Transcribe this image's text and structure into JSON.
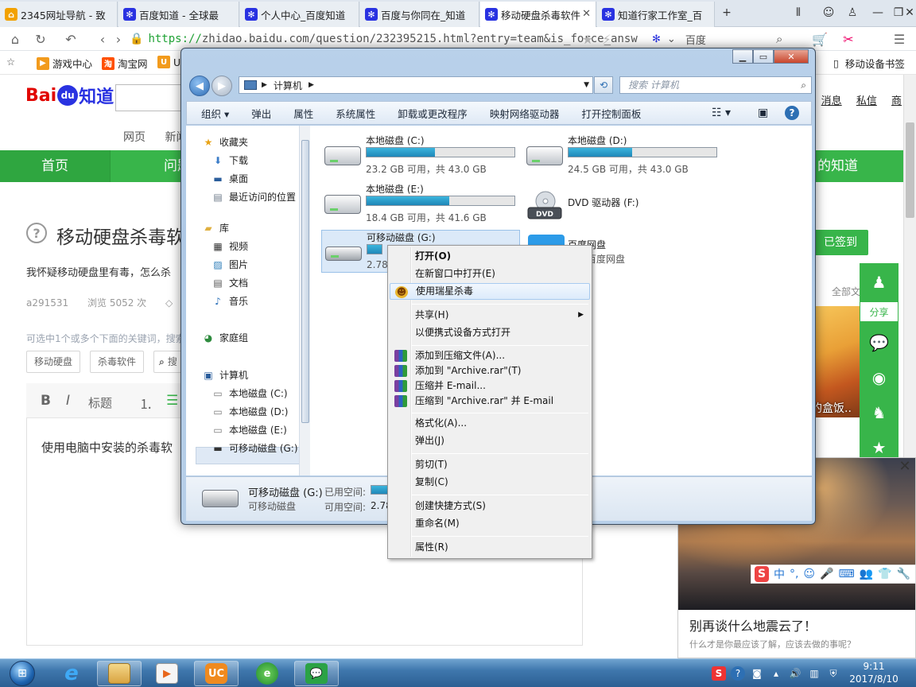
{
  "browser": {
    "tabs": [
      {
        "label": "2345网址导航 - 致",
        "icon": "2345-icon"
      },
      {
        "label": "百度知道 - 全球最",
        "icon": "baidu-paw-icon"
      },
      {
        "label": "个人中心_百度知道",
        "icon": "baidu-paw-icon"
      },
      {
        "label": "百度与你同在_知道",
        "icon": "baidu-paw-icon"
      },
      {
        "label": "移动硬盘杀毒软件",
        "icon": "baidu-paw-icon"
      },
      {
        "label": "知道行家工作室_百",
        "icon": "baidu-paw-icon"
      }
    ],
    "new_tab": "+",
    "url_https": "https://",
    "url_rest": "zhidao.baidu.com/question/232395215.html?entry=team&is_force_answ",
    "search_engine": "百度",
    "bookmarks": [
      "游戏中心",
      "淘宝网",
      "U"
    ],
    "mobile_bookmarks": "移动设备书签"
  },
  "page": {
    "logo_bai": "Bai",
    "logo_du": "du",
    "logo_zhidao": "知道",
    "subnav": [
      "网页",
      "新闻"
    ],
    "green_nav": {
      "home": "首页",
      "ask": "问题",
      "mine": "的知道"
    },
    "top_links": [
      "消息",
      "私信",
      "商"
    ],
    "question_title": "移动硬盘杀毒软",
    "question_desc": "我怀疑移动硬盘里有毒，怎么杀",
    "meta": {
      "user": "a291531",
      "views": "浏览 5052 次"
    },
    "hint": "可选中1个或多个下面的关键词，搜索",
    "tags": [
      "移动硬盘",
      "杀毒软件",
      "搜"
    ],
    "editor": {
      "bold": "B",
      "italic": "I",
      "heading": "标题"
    },
    "answer_text": "使用电脑中安装的杀毒软",
    "signed": "已签到",
    "all_questions": "全部文",
    "share_label": "分享",
    "food_caption": "的盒饭..",
    "news_title": "别再谈什么地震云了！",
    "news_sub": "什么才是你最应该了解，应该去做的事呢？"
  },
  "ime": {
    "mode": "中",
    "punct": "°,"
  },
  "explorer": {
    "breadcrumb": "计算机",
    "search_placeholder": "搜索 计算机",
    "commands": [
      "组织 ▾",
      "弹出",
      "属性",
      "系统属性",
      "卸载或更改程序",
      "映射网络驱动器",
      "打开控制面板"
    ],
    "nav": {
      "favorites": "收藏夹",
      "downloads": "下载",
      "desktop": "桌面",
      "recent": "最近访问的位置",
      "libraries": "库",
      "videos": "视频",
      "pictures": "图片",
      "documents": "文档",
      "music": "音乐",
      "homegroup": "家庭组",
      "computer": "计算机",
      "drive_c": "本地磁盘 (C:)",
      "drive_d": "本地磁盘 (D:)",
      "drive_e": "本地磁盘 (E:)",
      "drive_g": "可移动磁盘 (G:)"
    },
    "drives": [
      {
        "name": "本地磁盘 (C:)",
        "free": "23.2 GB 可用，共 43.0 GB",
        "used_fraction": 0.46
      },
      {
        "name": "本地磁盘 (D:)",
        "free": "24.5 GB 可用，共 43.0 GB",
        "used_fraction": 0.43
      },
      {
        "name": "本地磁盘 (E:)",
        "free": "18.4 GB 可用，共 41.6 GB",
        "used_fraction": 0.56
      },
      {
        "name": "可移动磁盘 (G:)",
        "free": "2.78",
        "used_fraction": 0.35
      }
    ],
    "dvd": {
      "name": "DVD 驱动器 (F:)",
      "badge": "DVD"
    },
    "baiduwp": {
      "name": "百度网盘",
      "sub": "运行百度网盘"
    },
    "details": {
      "name": "可移动磁盘 (G:)",
      "type": "可移动磁盘",
      "used_label": "已用空间:",
      "free_label": "可用空间:",
      "free_value": "2.78"
    }
  },
  "context_menu": {
    "items": [
      {
        "label": "打开(O)",
        "bold": true
      },
      {
        "label": "在新窗口中打开(E)"
      },
      {
        "label": "使用瑞星杀毒",
        "icon": "rising-lion-icon",
        "highlighted": true
      },
      {
        "label": "共享(H)",
        "submenu": true
      },
      {
        "label": "以便携式设备方式打开"
      },
      {
        "label": "添加到压缩文件(A)...",
        "icon": "winrar-icon"
      },
      {
        "label": "添加到 \"Archive.rar\"(T)",
        "icon": "winrar-icon"
      },
      {
        "label": "压缩并 E-mail...",
        "icon": "winrar-icon"
      },
      {
        "label": "压缩到 \"Archive.rar\" 并 E-mail",
        "icon": "winrar-icon"
      },
      {
        "label": "格式化(A)..."
      },
      {
        "label": "弹出(J)"
      },
      {
        "label": "剪切(T)"
      },
      {
        "label": "复制(C)"
      },
      {
        "label": "创建快捷方式(S)"
      },
      {
        "label": "重命名(M)"
      },
      {
        "label": "属性(R)"
      }
    ]
  },
  "taskbar": {
    "time": "9:11",
    "date": "2017/8/10"
  },
  "colors": {
    "baidu_green": "#38b54a",
    "baidu_red": "#e10602",
    "baidu_blue": "#2932e1",
    "drive_fill": "#1f87b8"
  }
}
